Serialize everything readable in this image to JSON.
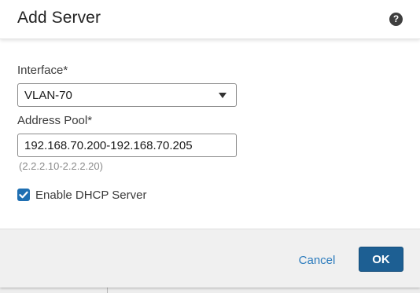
{
  "dialog": {
    "title": "Add Server",
    "help_icon": "?"
  },
  "form": {
    "interface": {
      "label": "Interface*",
      "selected": "VLAN-70"
    },
    "address_pool": {
      "label": "Address Pool*",
      "value": "192.168.70.200-192.168.70.205",
      "hint": "(2.2.2.10-2.2.2.20)"
    },
    "enable_dhcp": {
      "label": "Enable DHCP Server",
      "checked": true
    }
  },
  "footer": {
    "cancel_label": "Cancel",
    "ok_label": "OK"
  },
  "colors": {
    "primary": "#1d5f93",
    "link": "#2b7bbd",
    "checkbox": "#1f6fb2"
  },
  "icons": {
    "help": "question-circle-icon",
    "dropdown": "caret-down-icon",
    "check": "checkmark-icon"
  }
}
